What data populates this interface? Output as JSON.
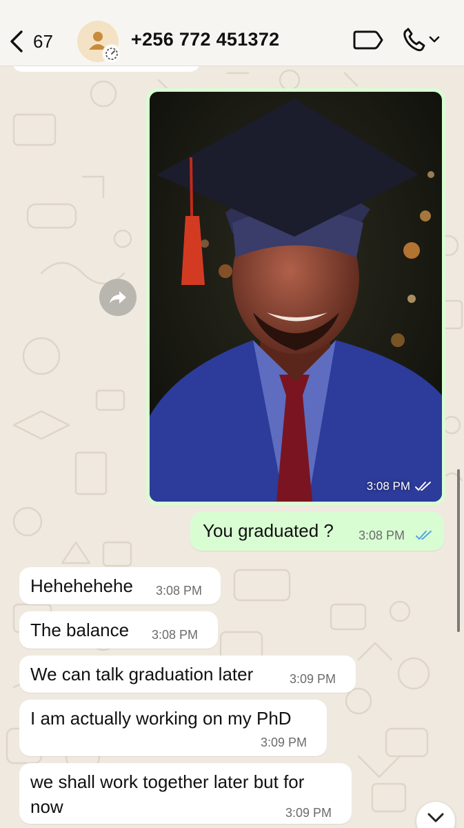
{
  "header": {
    "back_count": "67",
    "contact_name": "+256 772 451372",
    "icons": [
      "chevron-left-icon",
      "person-icon",
      "timer-icon",
      "video-call-icon",
      "phone-icon",
      "chevron-down-icon"
    ]
  },
  "colors": {
    "outgoing_bubble": "#d9fdd3",
    "incoming_bubble": "#ffffff",
    "read_ticks": "#4fa3e6",
    "wallpaper": "#efe9df"
  },
  "messages": [
    {
      "type": "image",
      "direction": "outgoing",
      "time": "3:08 PM",
      "status": "read"
    },
    {
      "type": "text",
      "direction": "outgoing",
      "text": "You graduated ?",
      "time": "3:08 PM",
      "status": "read"
    },
    {
      "type": "text",
      "direction": "incoming",
      "text": "Hehehehehe",
      "time": "3:08 PM"
    },
    {
      "type": "text",
      "direction": "incoming",
      "text": "The balance",
      "time": "3:08 PM"
    },
    {
      "type": "text",
      "direction": "incoming",
      "text": "We can talk graduation later",
      "time": "3:09 PM"
    },
    {
      "type": "text",
      "direction": "incoming",
      "text": "I am actually working on my PhD",
      "time": "3:09 PM"
    },
    {
      "type": "text",
      "direction": "incoming",
      "text_line1": "we shall work together later but for",
      "text_line2": "now",
      "time": "3:09 PM"
    }
  ]
}
